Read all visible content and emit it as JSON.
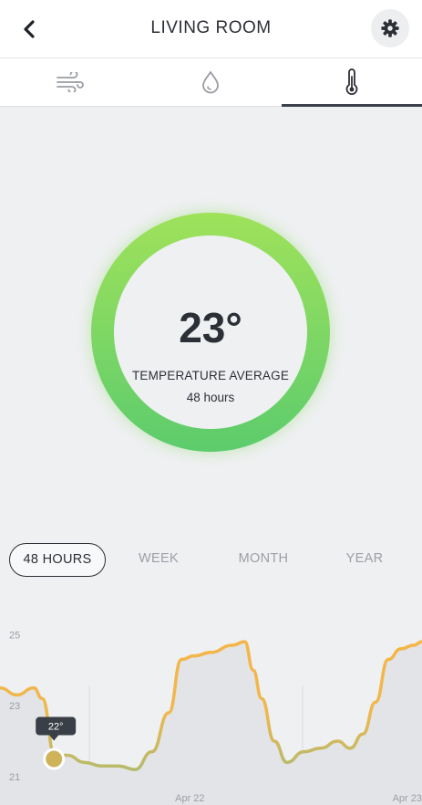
{
  "header": {
    "title": "LIVING ROOM",
    "back_icon": "chevron-left-icon",
    "settings_icon": "gear-icon"
  },
  "tabs": [
    {
      "icon": "wind-icon",
      "active": false
    },
    {
      "icon": "humidity-drop-icon",
      "active": false
    },
    {
      "icon": "thermometer-icon",
      "active": true
    }
  ],
  "gauge": {
    "value": "23°",
    "label": "TEMPERATURE AVERAGE",
    "period": "48 hours"
  },
  "ranges": {
    "h48": "48 HOURS",
    "week": "WEEK",
    "month": "MONTH",
    "year": "YEAR",
    "active": "48 HOURS"
  },
  "colors": {
    "ring_top": "#9fe25a",
    "ring_bottom": "#5ccc6c",
    "line_warm": "#f3b94b",
    "line_cool": "#c4b968",
    "marker": "#cfb35b"
  },
  "chart_data": {
    "type": "line",
    "y_ticks": [
      "25",
      "23",
      "21"
    ],
    "ylim": [
      20.2,
      25.6
    ],
    "x_labels": [
      {
        "label": "Apr 22",
        "t": 0.45
      },
      {
        "label": "Apr 23",
        "t": 0.965
      }
    ],
    "x": [
      0,
      0.04,
      0.08,
      0.1,
      0.13,
      0.16,
      0.2,
      0.24,
      0.28,
      0.32,
      0.36,
      0.4,
      0.43,
      0.46,
      0.5,
      0.55,
      0.58,
      0.6,
      0.62,
      0.65,
      0.68,
      0.72,
      0.76,
      0.8,
      0.83,
      0.86,
      0.89,
      0.92,
      0.95,
      0.98,
      1.0
    ],
    "y": [
      23.5,
      23.3,
      23.5,
      23.2,
      21.6,
      21.6,
      21.4,
      21.3,
      21.3,
      21.2,
      21.7,
      22.8,
      24.3,
      24.4,
      24.5,
      24.7,
      24.8,
      24.0,
      23.2,
      22.0,
      21.4,
      21.7,
      21.8,
      22.0,
      21.8,
      22.2,
      23.1,
      24.3,
      24.6,
      24.7,
      24.8
    ],
    "highlight": {
      "index": 4,
      "label": "22°"
    }
  }
}
